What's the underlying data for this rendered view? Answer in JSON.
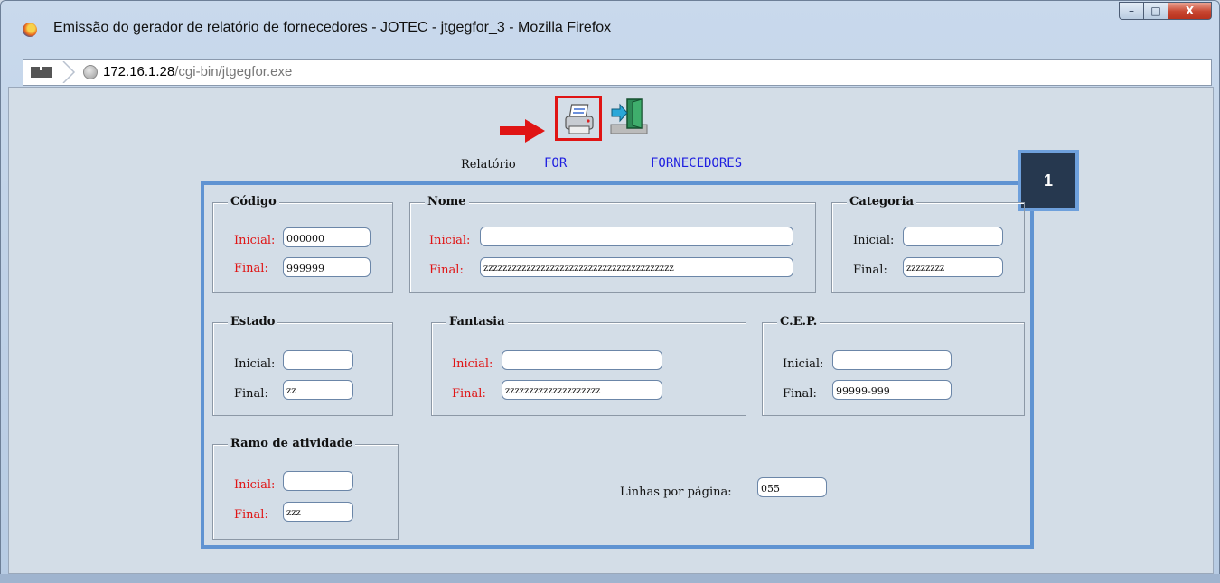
{
  "window": {
    "title": "Emissão do gerador de relatório de fornecedores - JOTEC - jtgegfor_3 - Mozilla Firefox",
    "controls": {
      "minimize": "–",
      "maximize": "□",
      "close": "X"
    }
  },
  "address": {
    "host": "172.16.1.28",
    "path": "/cgi-bin/jtgegfor.exe"
  },
  "toolbar": {
    "print_icon": "printer-icon",
    "exit_icon": "exit-door-icon",
    "arrow_color": "#e01414"
  },
  "report": {
    "label": "Relatório",
    "code": "FOR",
    "name": "FORNECEDORES"
  },
  "badge": "1",
  "groups": {
    "codigo": {
      "title": "Código",
      "inicial_label": "Inicial:",
      "final_label": "Final:",
      "inicial": "000000",
      "final": "999999"
    },
    "nome": {
      "title": "Nome",
      "inicial_label": "Inicial:",
      "final_label": "Final:",
      "inicial": "",
      "final": "zzzzzzzzzzzzzzzzzzzzzzzzzzzzzzzzzzzzzzzz"
    },
    "categoria": {
      "title": "Categoria",
      "inicial_label": "Inicial:",
      "final_label": "Final:",
      "inicial": "",
      "final": "zzzzzzzz"
    },
    "estado": {
      "title": "Estado",
      "inicial_label": "Inicial:",
      "final_label": "Final:",
      "inicial": "",
      "final": "zz"
    },
    "fantasia": {
      "title": "Fantasia",
      "inicial_label": "Inicial:",
      "final_label": "Final:",
      "inicial": "",
      "final": "zzzzzzzzzzzzzzzzzzzz"
    },
    "cep": {
      "title": "C.E.P.",
      "inicial_label": "Inicial:",
      "final_label": "Final:",
      "inicial": "",
      "final": "99999-999"
    },
    "ramo": {
      "title": "Ramo de atividade",
      "inicial_label": "Inicial:",
      "final_label": "Final:",
      "inicial": "",
      "final": "zzz"
    }
  },
  "linhas": {
    "label": "Linhas por página:",
    "value": "055"
  }
}
